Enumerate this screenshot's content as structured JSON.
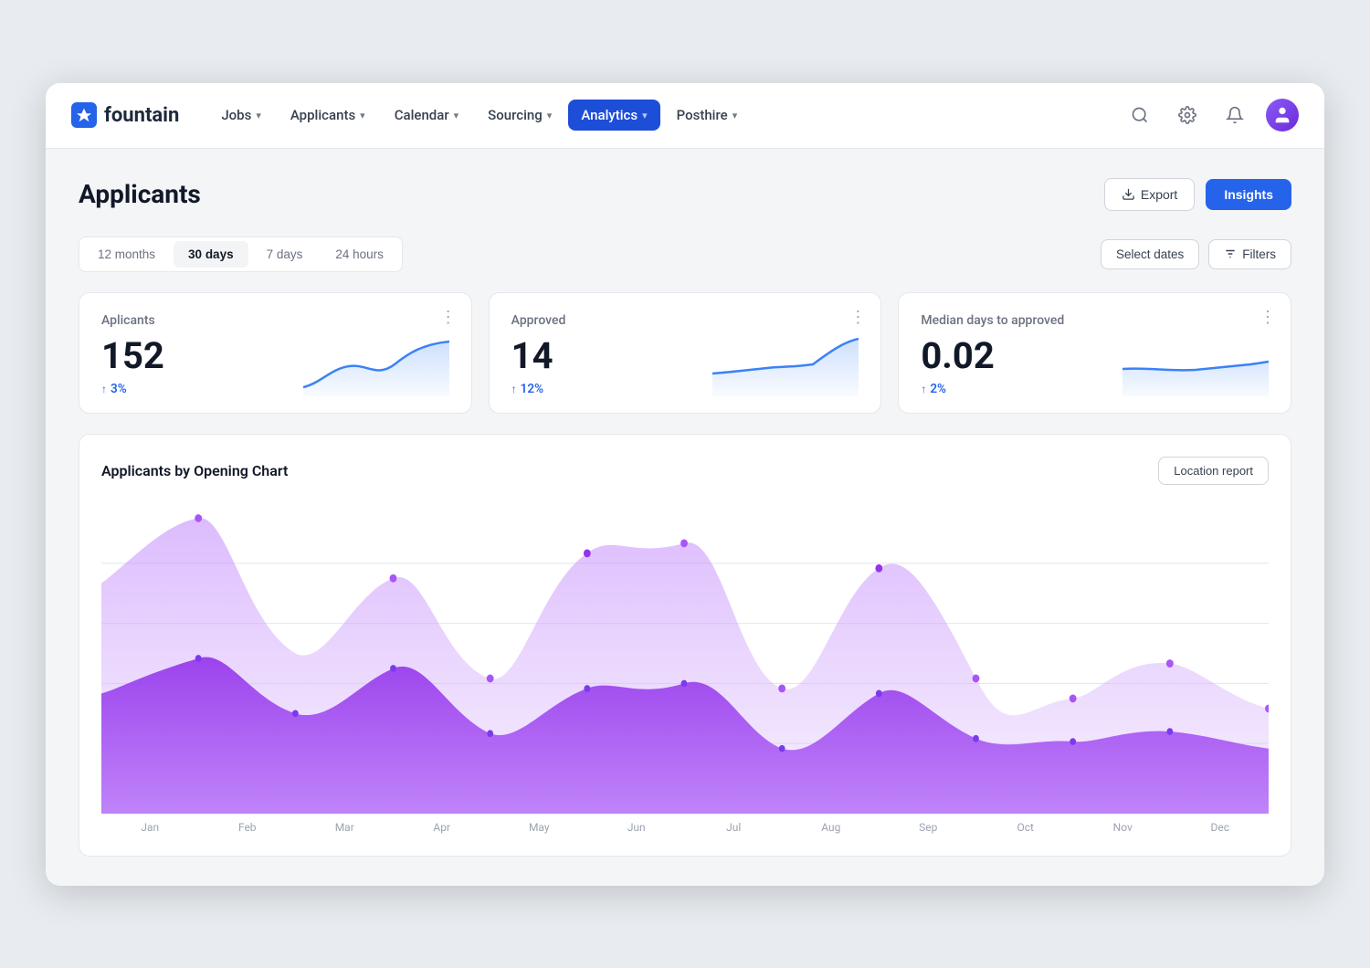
{
  "brand": {
    "name": "fountain",
    "icon": "✦"
  },
  "nav": {
    "items": [
      {
        "label": "Jobs",
        "chevron": true,
        "active": false
      },
      {
        "label": "Applicants",
        "chevron": true,
        "active": false
      },
      {
        "label": "Calendar",
        "chevron": true,
        "active": false
      },
      {
        "label": "Sourcing",
        "chevron": true,
        "active": false
      },
      {
        "label": "Analytics",
        "chevron": true,
        "active": true
      },
      {
        "label": "Posthire",
        "chevron": true,
        "active": false
      }
    ],
    "icons": {
      "search": "🔍",
      "settings": "⚙",
      "notifications": "🔔"
    }
  },
  "page": {
    "title": "Applicants",
    "export_label": "Export",
    "insights_label": "Insights"
  },
  "time_filters": {
    "options": [
      {
        "label": "12 months",
        "active": false
      },
      {
        "label": "30 days",
        "active": true
      },
      {
        "label": "7 days",
        "active": false
      },
      {
        "label": "24 hours",
        "active": false
      }
    ],
    "select_dates_label": "Select dates",
    "filters_label": "Filters"
  },
  "stat_cards": [
    {
      "label": "Aplicants",
      "value": "152",
      "change": "3%",
      "change_dir": "up",
      "sparkline_color": "#3b82f6"
    },
    {
      "label": "Approved",
      "value": "14",
      "change": "12%",
      "change_dir": "up",
      "sparkline_color": "#3b82f6"
    },
    {
      "label": "Median days to approved",
      "value": "0.02",
      "change": "2%",
      "change_dir": "up",
      "sparkline_color": "#3b82f6"
    }
  ],
  "chart": {
    "title": "Applicants by Opening Chart",
    "location_report_label": "Location report",
    "x_labels": [
      "Jan",
      "Feb",
      "Mar",
      "Apr",
      "May",
      "Jun",
      "Jul",
      "Aug",
      "Sep",
      "Oct",
      "Nov",
      "Dec"
    ]
  }
}
